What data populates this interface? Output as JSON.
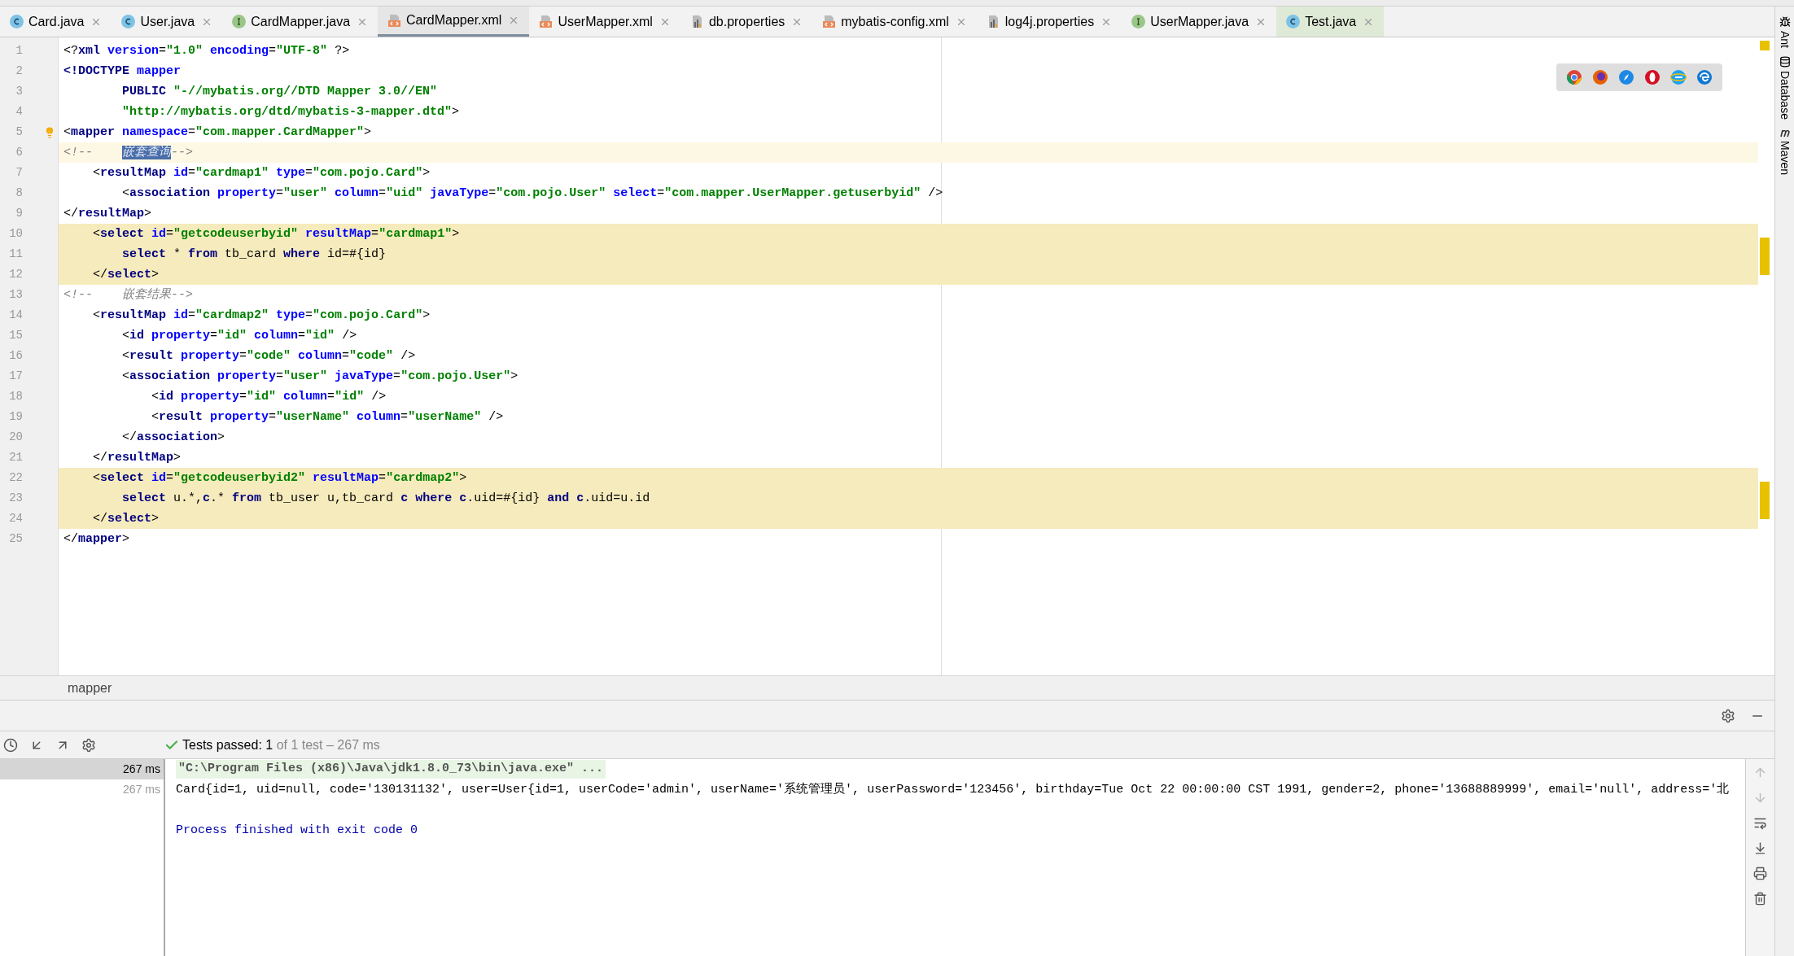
{
  "tabs": [
    {
      "label": "Card.java",
      "kind": "class",
      "selected": false
    },
    {
      "label": "User.java",
      "kind": "class",
      "selected": false
    },
    {
      "label": "CardMapper.java",
      "kind": "interface",
      "selected": false
    },
    {
      "label": "CardMapper.xml",
      "kind": "xml",
      "selected": true
    },
    {
      "label": "UserMapper.xml",
      "kind": "xml",
      "selected": false
    },
    {
      "label": "db.properties",
      "kind": "properties",
      "selected": false
    },
    {
      "label": "mybatis-config.xml",
      "kind": "xml",
      "selected": false
    },
    {
      "label": "log4j.properties",
      "kind": "properties",
      "selected": false
    },
    {
      "label": "UserMapper.java",
      "kind": "interface",
      "selected": false
    },
    {
      "label": "Test.java",
      "kind": "test",
      "selected": false
    }
  ],
  "editor": {
    "lines": [
      {
        "number": "1",
        "highlighted": false,
        "current": false,
        "tokens": [
          {
            "kind": "p",
            "text": "<?"
          },
          {
            "kind": "tag",
            "text": "xml"
          },
          {
            "kind": "attr",
            "text": " version"
          },
          {
            "kind": "p",
            "text": "="
          },
          {
            "kind": "str",
            "text": "\"1.0\""
          },
          {
            "kind": "attr",
            "text": " encoding"
          },
          {
            "kind": "p",
            "text": "="
          },
          {
            "kind": "str",
            "text": "\"UTF-8\""
          },
          {
            "kind": "p",
            "text": " ?>"
          }
        ]
      },
      {
        "number": "2",
        "highlighted": false,
        "current": false,
        "tokens": [
          {
            "kind": "tag",
            "text": "<!DOCTYPE"
          },
          {
            "kind": "attr",
            "text": " mapper"
          }
        ]
      },
      {
        "number": "3",
        "highlighted": false,
        "current": false,
        "tokens": [
          {
            "kind": "tag",
            "text": "        PUBLIC"
          },
          {
            "kind": "str",
            "text": " \"-//mybatis.org//DTD Mapper 3.0//EN\""
          }
        ]
      },
      {
        "number": "4",
        "highlighted": false,
        "current": false,
        "tokens": [
          {
            "kind": "str",
            "text": "        \"http://mybatis.org/dtd/mybatis-3-mapper.dtd\""
          },
          {
            "kind": "p",
            "text": ">"
          }
        ]
      },
      {
        "number": "5",
        "highlighted": false,
        "current": false,
        "tokens": [
          {
            "kind": "p",
            "text": "<"
          },
          {
            "kind": "tag",
            "text": "mapper"
          },
          {
            "kind": "attr",
            "text": " namespace"
          },
          {
            "kind": "p",
            "text": "="
          },
          {
            "kind": "str",
            "text": "\"com.mapper.CardMapper\""
          },
          {
            "kind": "p",
            "text": ">"
          }
        ]
      },
      {
        "number": "6",
        "highlighted": false,
        "current": true,
        "tokens": [
          {
            "kind": "comment",
            "text": "<!--    "
          },
          {
            "kind": "sel",
            "text": "嵌套查询"
          },
          {
            "kind": "comment",
            "text": "-->"
          }
        ]
      },
      {
        "number": "7",
        "highlighted": false,
        "current": false,
        "tokens": [
          {
            "kind": "p",
            "text": "    <"
          },
          {
            "kind": "tag",
            "text": "resultMap"
          },
          {
            "kind": "attr",
            "text": " id"
          },
          {
            "kind": "p",
            "text": "="
          },
          {
            "kind": "str",
            "text": "\"cardmap1\""
          },
          {
            "kind": "attr",
            "text": " type"
          },
          {
            "kind": "p",
            "text": "="
          },
          {
            "kind": "str",
            "text": "\"com.pojo.Card\""
          },
          {
            "kind": "p",
            "text": ">"
          }
        ]
      },
      {
        "number": "8",
        "highlighted": false,
        "current": false,
        "tokens": [
          {
            "kind": "p",
            "text": "        <"
          },
          {
            "kind": "tag",
            "text": "association"
          },
          {
            "kind": "attr",
            "text": " property"
          },
          {
            "kind": "p",
            "text": "="
          },
          {
            "kind": "str",
            "text": "\"user\""
          },
          {
            "kind": "attr",
            "text": " column"
          },
          {
            "kind": "p",
            "text": "="
          },
          {
            "kind": "str",
            "text": "\"uid\""
          },
          {
            "kind": "attr",
            "text": " javaType"
          },
          {
            "kind": "p",
            "text": "="
          },
          {
            "kind": "str",
            "text": "\"com.pojo.User\""
          },
          {
            "kind": "attr",
            "text": " select"
          },
          {
            "kind": "p",
            "text": "="
          },
          {
            "kind": "str",
            "text": "\"com.mapper.UserMapper.getuserbyid\""
          },
          {
            "kind": "p",
            "text": " />"
          }
        ]
      },
      {
        "number": "9",
        "highlighted": false,
        "current": false,
        "tokens": [
          {
            "kind": "p",
            "text": "</"
          },
          {
            "kind": "tag",
            "text": "resultMap"
          },
          {
            "kind": "p",
            "text": ">"
          }
        ]
      },
      {
        "number": "10",
        "highlighted": true,
        "current": false,
        "tokens": [
          {
            "kind": "p",
            "text": "    <"
          },
          {
            "kind": "tag",
            "text": "select"
          },
          {
            "kind": "attr",
            "text": " id"
          },
          {
            "kind": "p",
            "text": "="
          },
          {
            "kind": "str",
            "text": "\"getcodeuserbyid\""
          },
          {
            "kind": "attr",
            "text": " resultMap"
          },
          {
            "kind": "p",
            "text": "="
          },
          {
            "kind": "str",
            "text": "\"cardmap1\""
          },
          {
            "kind": "p",
            "text": ">"
          }
        ]
      },
      {
        "number": "11",
        "highlighted": true,
        "current": false,
        "tokens": [
          {
            "kind": "kw",
            "text": "        select"
          },
          {
            "kind": "p",
            "text": " * "
          },
          {
            "kind": "kw",
            "text": "from"
          },
          {
            "kind": "p",
            "text": " tb_card "
          },
          {
            "kind": "kw",
            "text": "where"
          },
          {
            "kind": "p",
            "text": " id=#{id}"
          }
        ]
      },
      {
        "number": "12",
        "highlighted": true,
        "current": false,
        "tokens": [
          {
            "kind": "p",
            "text": "    </"
          },
          {
            "kind": "tag",
            "text": "select"
          },
          {
            "kind": "p",
            "text": ">"
          }
        ]
      },
      {
        "number": "13",
        "highlighted": false,
        "current": false,
        "tokens": [
          {
            "kind": "comment",
            "text": "<!--    嵌套结果-->"
          }
        ]
      },
      {
        "number": "14",
        "highlighted": false,
        "current": false,
        "tokens": [
          {
            "kind": "p",
            "text": "    <"
          },
          {
            "kind": "tag",
            "text": "resultMap"
          },
          {
            "kind": "attr",
            "text": " id"
          },
          {
            "kind": "p",
            "text": "="
          },
          {
            "kind": "str",
            "text": "\"cardmap2\""
          },
          {
            "kind": "attr",
            "text": " type"
          },
          {
            "kind": "p",
            "text": "="
          },
          {
            "kind": "str",
            "text": "\"com.pojo.Card\""
          },
          {
            "kind": "p",
            "text": ">"
          }
        ]
      },
      {
        "number": "15",
        "highlighted": false,
        "current": false,
        "tokens": [
          {
            "kind": "p",
            "text": "        <"
          },
          {
            "kind": "tag",
            "text": "id"
          },
          {
            "kind": "attr",
            "text": " property"
          },
          {
            "kind": "p",
            "text": "="
          },
          {
            "kind": "str",
            "text": "\"id\""
          },
          {
            "kind": "attr",
            "text": " column"
          },
          {
            "kind": "p",
            "text": "="
          },
          {
            "kind": "str",
            "text": "\"id\""
          },
          {
            "kind": "p",
            "text": " />"
          }
        ]
      },
      {
        "number": "16",
        "highlighted": false,
        "current": false,
        "tokens": [
          {
            "kind": "p",
            "text": "        <"
          },
          {
            "kind": "tag",
            "text": "result"
          },
          {
            "kind": "attr",
            "text": " property"
          },
          {
            "kind": "p",
            "text": "="
          },
          {
            "kind": "str",
            "text": "\"code\""
          },
          {
            "kind": "attr",
            "text": " column"
          },
          {
            "kind": "p",
            "text": "="
          },
          {
            "kind": "str",
            "text": "\"code\""
          },
          {
            "kind": "p",
            "text": " />"
          }
        ]
      },
      {
        "number": "17",
        "highlighted": false,
        "current": false,
        "tokens": [
          {
            "kind": "p",
            "text": "        <"
          },
          {
            "kind": "tag",
            "text": "association"
          },
          {
            "kind": "attr",
            "text": " property"
          },
          {
            "kind": "p",
            "text": "="
          },
          {
            "kind": "str",
            "text": "\"user\""
          },
          {
            "kind": "attr",
            "text": " javaType"
          },
          {
            "kind": "p",
            "text": "="
          },
          {
            "kind": "str",
            "text": "\"com.pojo.User\""
          },
          {
            "kind": "p",
            "text": ">"
          }
        ]
      },
      {
        "number": "18",
        "highlighted": false,
        "current": false,
        "tokens": [
          {
            "kind": "p",
            "text": "            <"
          },
          {
            "kind": "tag",
            "text": "id"
          },
          {
            "kind": "attr",
            "text": " property"
          },
          {
            "kind": "p",
            "text": "="
          },
          {
            "kind": "str",
            "text": "\"id\""
          },
          {
            "kind": "attr",
            "text": " column"
          },
          {
            "kind": "p",
            "text": "="
          },
          {
            "kind": "str",
            "text": "\"id\""
          },
          {
            "kind": "p",
            "text": " />"
          }
        ]
      },
      {
        "number": "19",
        "highlighted": false,
        "current": false,
        "tokens": [
          {
            "kind": "p",
            "text": "            <"
          },
          {
            "kind": "tag",
            "text": "result"
          },
          {
            "kind": "attr",
            "text": " property"
          },
          {
            "kind": "p",
            "text": "="
          },
          {
            "kind": "str",
            "text": "\"userName\""
          },
          {
            "kind": "attr",
            "text": " column"
          },
          {
            "kind": "p",
            "text": "="
          },
          {
            "kind": "str",
            "text": "\"userName\""
          },
          {
            "kind": "p",
            "text": " />"
          }
        ]
      },
      {
        "number": "20",
        "highlighted": false,
        "current": false,
        "tokens": [
          {
            "kind": "p",
            "text": "        </"
          },
          {
            "kind": "tag",
            "text": "association"
          },
          {
            "kind": "p",
            "text": ">"
          }
        ]
      },
      {
        "number": "21",
        "highlighted": false,
        "current": false,
        "tokens": [
          {
            "kind": "p",
            "text": "    </"
          },
          {
            "kind": "tag",
            "text": "resultMap"
          },
          {
            "kind": "p",
            "text": ">"
          }
        ]
      },
      {
        "number": "22",
        "highlighted": true,
        "current": false,
        "tokens": [
          {
            "kind": "p",
            "text": "    <"
          },
          {
            "kind": "tag",
            "text": "select"
          },
          {
            "kind": "attr",
            "text": " id"
          },
          {
            "kind": "p",
            "text": "="
          },
          {
            "kind": "str",
            "text": "\"getcodeuserbyid2\""
          },
          {
            "kind": "attr",
            "text": " resultMap"
          },
          {
            "kind": "p",
            "text": "="
          },
          {
            "kind": "str",
            "text": "\"cardmap2\""
          },
          {
            "kind": "p",
            "text": ">"
          }
        ]
      },
      {
        "number": "23",
        "highlighted": true,
        "current": false,
        "tokens": [
          {
            "kind": "kw",
            "text": "        select"
          },
          {
            "kind": "p",
            "text": " u.*,"
          },
          {
            "kind": "kw",
            "text": "c"
          },
          {
            "kind": "p",
            "text": ".* "
          },
          {
            "kind": "kw",
            "text": "from"
          },
          {
            "kind": "p",
            "text": " tb_user u,tb_card "
          },
          {
            "kind": "kw",
            "text": "c where c"
          },
          {
            "kind": "p",
            "text": ".uid=#{id} "
          },
          {
            "kind": "kw",
            "text": "and c"
          },
          {
            "kind": "p",
            "text": ".uid=u.id"
          }
        ]
      },
      {
        "number": "24",
        "highlighted": true,
        "current": false,
        "tokens": [
          {
            "kind": "p",
            "text": "    </"
          },
          {
            "kind": "tag",
            "text": "select"
          },
          {
            "kind": "p",
            "text": ">"
          }
        ]
      },
      {
        "number": "25",
        "highlighted": false,
        "current": false,
        "tokens": [
          {
            "kind": "p",
            "text": "</"
          },
          {
            "kind": "tag",
            "text": "mapper"
          },
          {
            "kind": "p",
            "text": ">"
          }
        ]
      }
    ]
  },
  "breadcrumb": "mapper",
  "right_tools": [
    "Ant",
    "Database",
    "Maven"
  ],
  "run": {
    "status_label": "Tests passed: ",
    "passed": "1",
    "summary": " of 1 test – 267 ms",
    "tree": [
      {
        "time": "267 ms",
        "selected": true
      },
      {
        "time": "267 ms",
        "selected": false
      }
    ],
    "console": [
      {
        "kind": "command",
        "text": "\"C:\\Program Files (x86)\\Java\\jdk1.8.0_73\\bin\\java.exe\" ..."
      },
      {
        "kind": "output",
        "text": "Card{id=1, uid=null, code='130131132', user=User{id=1, userCode='admin', userName='系统管理员', userPassword='123456', birthday=Tue Oct 22 00:00:00 CST 1991, gender=2, phone='13688889999', email='null', address='北"
      },
      {
        "kind": "blank"
      },
      {
        "kind": "exit",
        "text": "Process finished with exit code 0"
      }
    ]
  }
}
